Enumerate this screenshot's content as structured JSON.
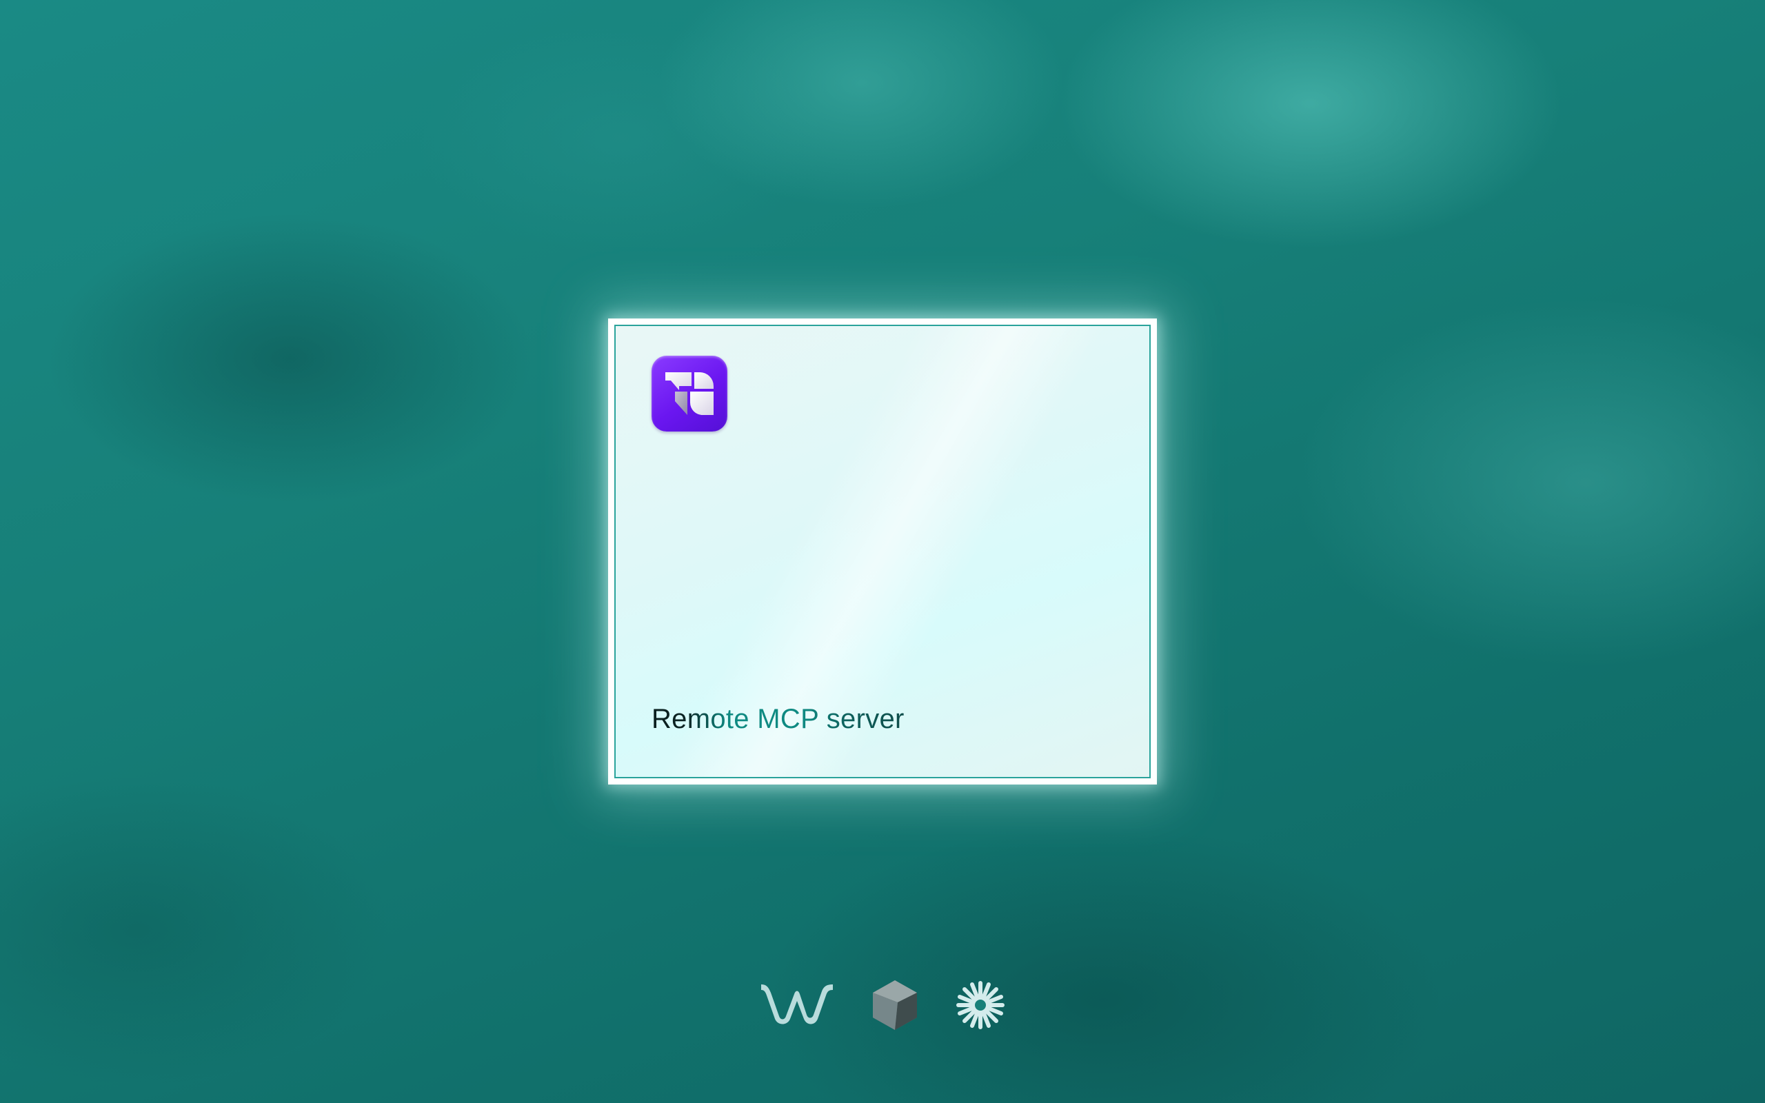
{
  "card": {
    "title": "Remote MCP server",
    "app_icon": "app-logo-icon"
  },
  "footer_logos": [
    {
      "icon": "w-wave-logo-icon"
    },
    {
      "icon": "cube-logo-icon"
    },
    {
      "icon": "starburst-logo-icon"
    }
  ],
  "colors": {
    "background": "#177f7b",
    "icon_purple": "#6a16f0",
    "title_accent": "#0f8a82"
  }
}
